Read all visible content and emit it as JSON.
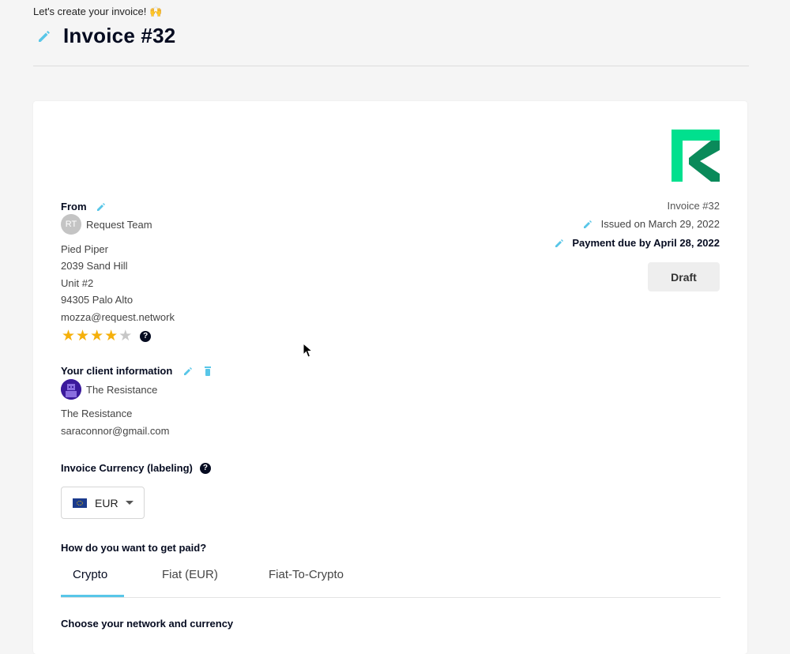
{
  "header": {
    "greeting": "Let's create your invoice!",
    "greeting_emoji": "🙌",
    "title": "Invoice #32"
  },
  "from": {
    "label": "From",
    "avatar_initials": "RT",
    "sender_name": "Request Team",
    "company": "Pied Piper",
    "street": "2039 Sand Hill",
    "unit": "Unit #2",
    "city": "94305 Palo Alto",
    "email": "mozza@request.network",
    "rating": 4,
    "rating_max": 5
  },
  "client": {
    "label": "Your client information",
    "name": "The Resistance",
    "company": "The Resistance",
    "email": "saraconnor@gmail.com"
  },
  "invoice_meta": {
    "number": "Invoice #32",
    "issued": "Issued on March 29, 2022",
    "due": "Payment due by April 28, 2022",
    "status": "Draft"
  },
  "currency": {
    "label": "Invoice Currency (labeling)",
    "selected": "EUR"
  },
  "payment": {
    "question": "How do you want to get paid?",
    "tabs": [
      "Crypto",
      "Fiat (EUR)",
      "Fiat-To-Crypto"
    ],
    "active_tab": "Crypto",
    "network_label": "Choose your network and currency"
  },
  "colors": {
    "accent": "#58c6e8",
    "brand_green": "#00cc8e",
    "star": "#f5b00b",
    "text": "#050b20"
  },
  "icons": [
    "pencil-icon",
    "trash-icon",
    "help-icon",
    "star-icon",
    "chevron-down-icon",
    "eu-flag-icon",
    "request-logo"
  ]
}
